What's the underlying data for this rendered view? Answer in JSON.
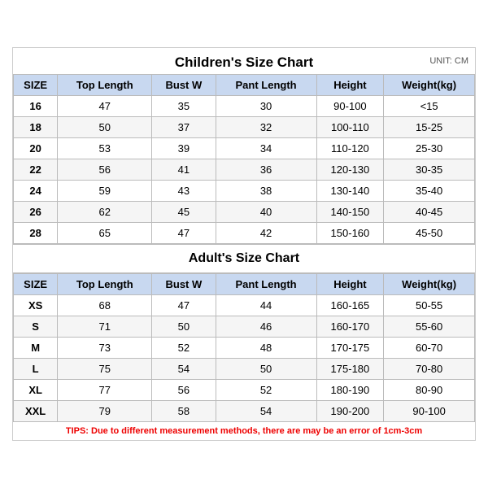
{
  "page": {
    "children_title": "Children's Size Chart",
    "adults_title": "Adult's Size Chart",
    "unit": "UNIT: CM",
    "tips": "TIPS: Due to different measurement methods, there are may be an error of 1cm-3cm",
    "columns": [
      "SIZE",
      "Top Length",
      "Bust W",
      "Pant Length",
      "Height",
      "Weight(kg)"
    ],
    "children_rows": [
      [
        "16",
        "47",
        "35",
        "30",
        "90-100",
        "<15"
      ],
      [
        "18",
        "50",
        "37",
        "32",
        "100-110",
        "15-25"
      ],
      [
        "20",
        "53",
        "39",
        "34",
        "110-120",
        "25-30"
      ],
      [
        "22",
        "56",
        "41",
        "36",
        "120-130",
        "30-35"
      ],
      [
        "24",
        "59",
        "43",
        "38",
        "130-140",
        "35-40"
      ],
      [
        "26",
        "62",
        "45",
        "40",
        "140-150",
        "40-45"
      ],
      [
        "28",
        "65",
        "47",
        "42",
        "150-160",
        "45-50"
      ]
    ],
    "adult_rows": [
      [
        "XS",
        "68",
        "47",
        "44",
        "160-165",
        "50-55"
      ],
      [
        "S",
        "71",
        "50",
        "46",
        "160-170",
        "55-60"
      ],
      [
        "M",
        "73",
        "52",
        "48",
        "170-175",
        "60-70"
      ],
      [
        "L",
        "75",
        "54",
        "50",
        "175-180",
        "70-80"
      ],
      [
        "XL",
        "77",
        "56",
        "52",
        "180-190",
        "80-90"
      ],
      [
        "XXL",
        "79",
        "58",
        "54",
        "190-200",
        "90-100"
      ]
    ]
  }
}
